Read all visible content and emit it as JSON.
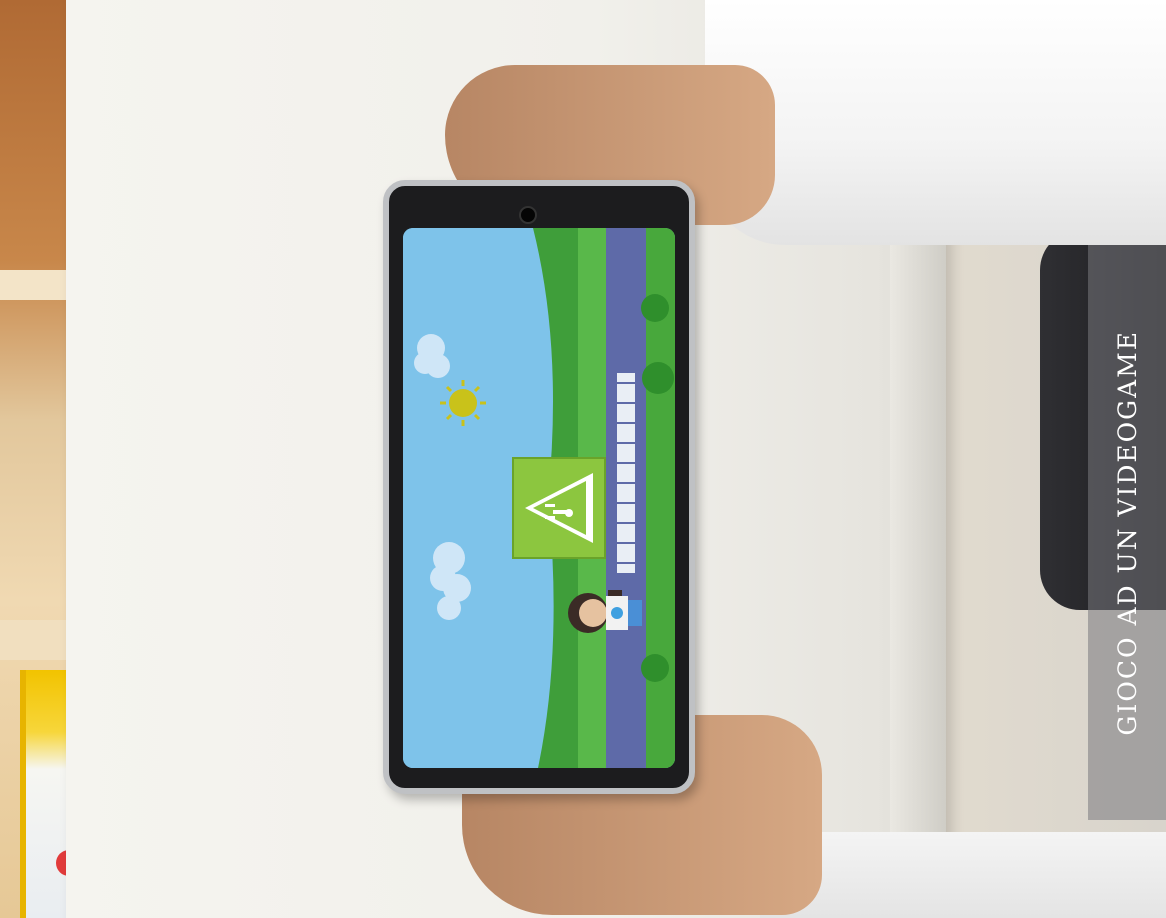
{
  "caption": {
    "text": "GIOCO AD UN VIDEOGAME"
  },
  "game": {
    "icons": {
      "sign": "pedestrian-crossing-sign-icon",
      "sun": "sun-icon",
      "character": "child-character-icon"
    }
  },
  "colors": {
    "sky": "#7ec3ea",
    "grass": "#59b84a",
    "road": "#5e6aa8",
    "sign": "#8cc63f"
  }
}
